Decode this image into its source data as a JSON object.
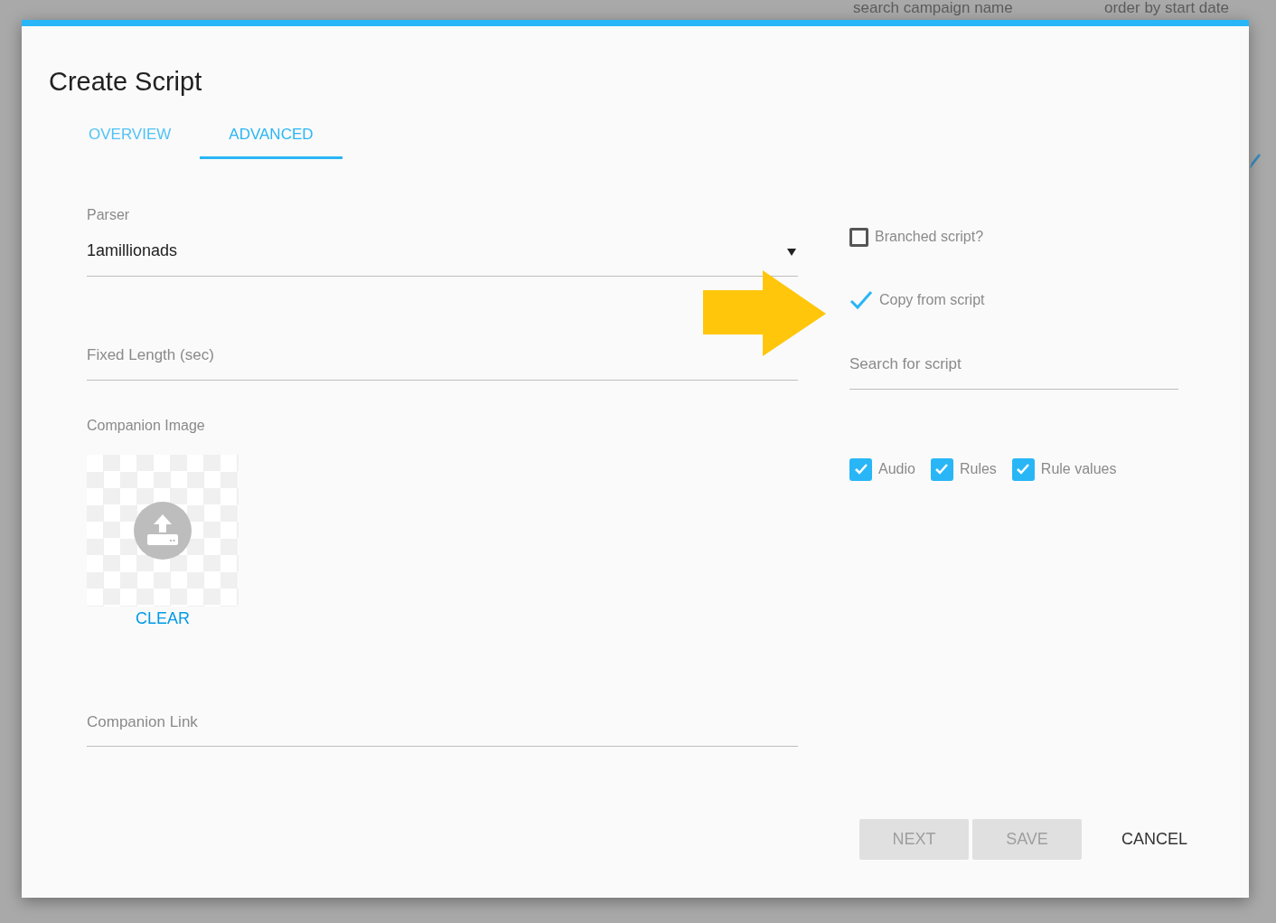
{
  "backdrop": {
    "search_placeholder": "search campaign name",
    "sort": "order by start date"
  },
  "dialog": {
    "title": "Create Script",
    "tabs": [
      {
        "label": "OVERVIEW",
        "selected": false
      },
      {
        "label": "ADVANCED",
        "selected": true
      }
    ],
    "parser": {
      "label": "Parser",
      "value": "1amillionads"
    },
    "fixed_length": {
      "placeholder": "Fixed Length (sec)"
    },
    "companion_image": {
      "label": "Companion Image",
      "clear": "CLEAR"
    },
    "companion_link": {
      "placeholder": "Companion Link"
    },
    "options": [
      {
        "kind": "box",
        "label": "Branched script?",
        "checked": false
      },
      {
        "kind": "tick",
        "label": "Copy from script",
        "checked": true
      }
    ],
    "search": {
      "placeholder": "Search for script"
    },
    "copy_items": [
      {
        "label": "Audio",
        "checked": true
      },
      {
        "label": "Rules",
        "checked": true
      },
      {
        "label": "Rule values",
        "checked": true
      }
    ],
    "buttons": [
      {
        "label": "NEXT",
        "disabled": true
      },
      {
        "label": "SAVE",
        "disabled": true
      },
      {
        "label": "CANCEL",
        "disabled": false
      }
    ]
  }
}
